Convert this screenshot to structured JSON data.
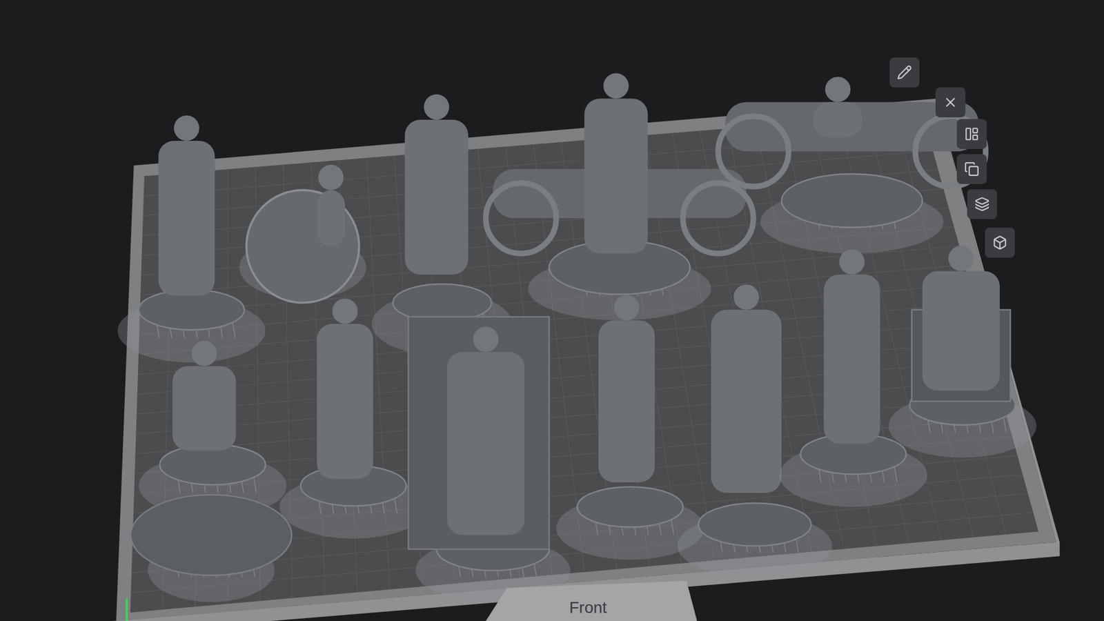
{
  "viewport": {
    "orientation_label": "Front"
  }
}
